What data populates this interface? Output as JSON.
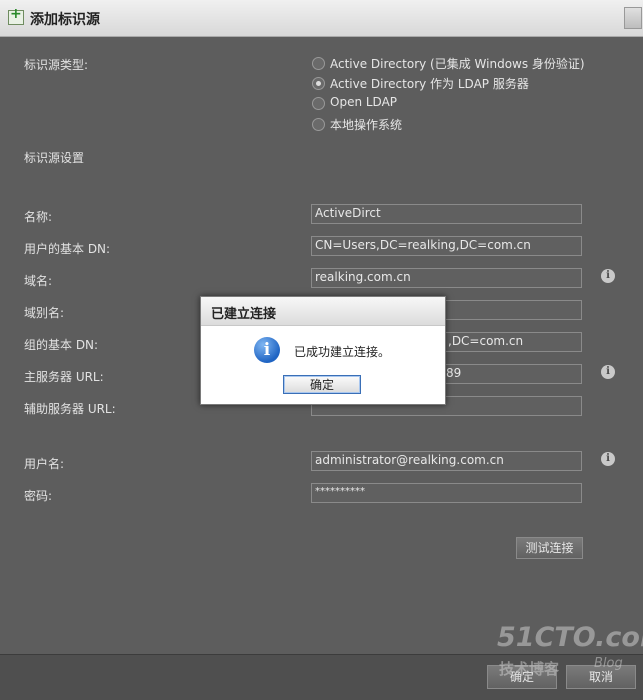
{
  "window": {
    "title": "添加标识源"
  },
  "form": {
    "source_type_label": "标识源类型:",
    "source_types": [
      {
        "label": "Active Directory (已集成 Windows 身份验证)",
        "selected": false
      },
      {
        "label": "Active Directory 作为 LDAP 服务器",
        "selected": true
      },
      {
        "label": "Open LDAP",
        "selected": false
      },
      {
        "label": "本地操作系统",
        "selected": false
      }
    ],
    "settings_label": "标识源设置",
    "fields": {
      "name": {
        "label": "名称:",
        "value": "ActiveDirct"
      },
      "base_dn_users": {
        "label": "用户的基本 DN:",
        "value": "CN=Users,DC=realking,DC=com.cn"
      },
      "domain_name": {
        "label": "域名:",
        "value": "realking.com.cn"
      },
      "domain_alias": {
        "label": "域别名:",
        "value": ""
      },
      "base_dn_groups": {
        "label": "组的基本 DN:",
        "value": ",DC=com.cn"
      },
      "primary_url": {
        "label": "主服务器 URL:",
        "value": "89"
      },
      "secondary_url": {
        "label": "辅助服务器 URL:",
        "value": ""
      },
      "username": {
        "label": "用户名:",
        "value": "administrator@realking.com.cn"
      },
      "password": {
        "label": "密码:",
        "value": "**********"
      }
    },
    "test_connection_label": "测试连接"
  },
  "dialog": {
    "title": "已建立连接",
    "message": "已成功建立连接。",
    "ok_label": "确定"
  },
  "footer": {
    "ok_label": "确定",
    "cancel_label": "取消"
  },
  "watermark": {
    "site": "51CTO.com",
    "sub": "技术博客",
    "blog": "Blog"
  },
  "icons": {
    "info": "info-icon",
    "dialog_info": "information-icon"
  }
}
